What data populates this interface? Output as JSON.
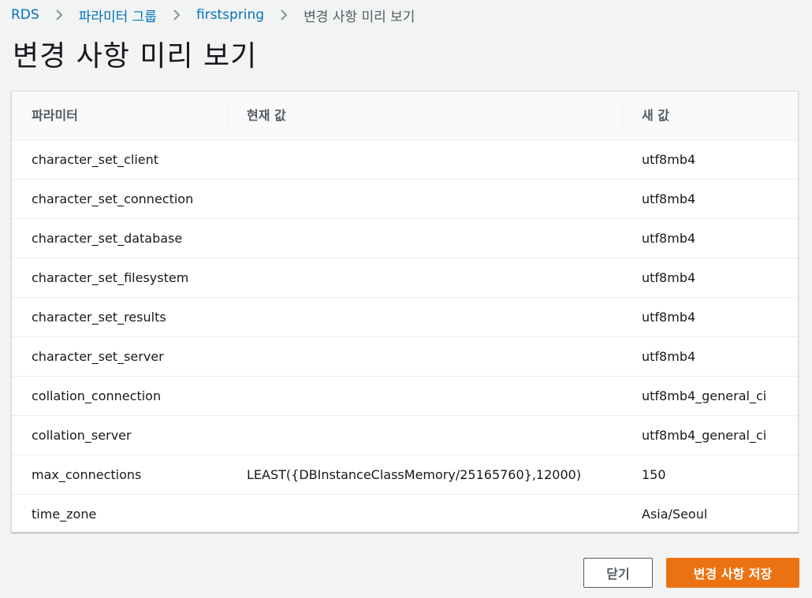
{
  "breadcrumb": {
    "items": [
      {
        "label": "RDS"
      },
      {
        "label": "파라미터 그룹"
      },
      {
        "label": "firstspring"
      },
      {
        "label": "변경 사항 미리 보기"
      }
    ],
    "separator_icon": "chevron-right-icon"
  },
  "page": {
    "title": "변경 사항 미리 보기"
  },
  "table": {
    "headers": {
      "parameter": "파라미터",
      "current_value": "현재 값",
      "new_value": "새 값"
    },
    "rows": [
      {
        "parameter": "character_set_client",
        "current_value": "",
        "new_value": "utf8mb4"
      },
      {
        "parameter": "character_set_connection",
        "current_value": "",
        "new_value": "utf8mb4"
      },
      {
        "parameter": "character_set_database",
        "current_value": "",
        "new_value": "utf8mb4"
      },
      {
        "parameter": "character_set_filesystem",
        "current_value": "",
        "new_value": "utf8mb4"
      },
      {
        "parameter": "character_set_results",
        "current_value": "",
        "new_value": "utf8mb4"
      },
      {
        "parameter": "character_set_server",
        "current_value": "",
        "new_value": "utf8mb4"
      },
      {
        "parameter": "collation_connection",
        "current_value": "",
        "new_value": "utf8mb4_general_ci"
      },
      {
        "parameter": "collation_server",
        "current_value": "",
        "new_value": "utf8mb4_general_ci"
      },
      {
        "parameter": "max_connections",
        "current_value": "LEAST({DBInstanceClassMemory/25165760},12000)",
        "new_value": "150"
      },
      {
        "parameter": "time_zone",
        "current_value": "",
        "new_value": "Asia/Seoul"
      }
    ]
  },
  "actions": {
    "close_label": "닫기",
    "save_label": "변경 사항 저장"
  },
  "colors": {
    "background": "#f2f3f3",
    "link": "#0073bb",
    "primary_button": "#ec7211"
  }
}
